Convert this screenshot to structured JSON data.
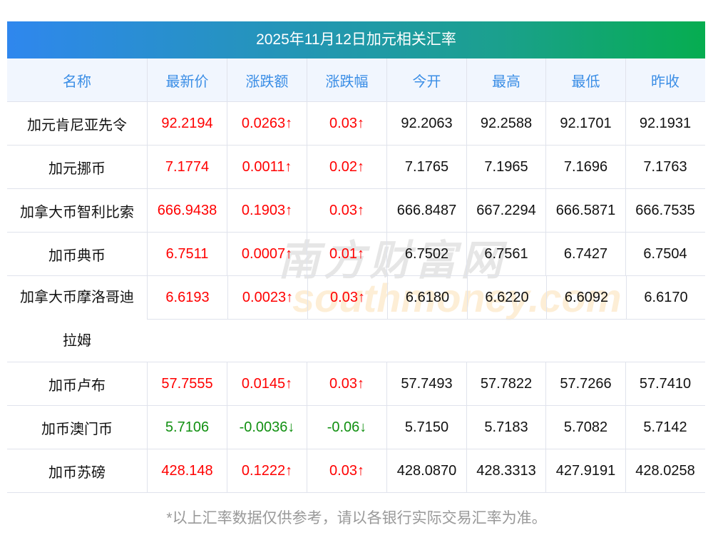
{
  "title": "2025年11月12日加元相关汇率",
  "headers": [
    "名称",
    "最新价",
    "涨跌额",
    "涨跌幅",
    "今开",
    "最高",
    "最低",
    "昨收"
  ],
  "rows": [
    {
      "name": "加元肯尼亚先令",
      "price": "92.2194",
      "chg": "0.0263↑",
      "pct": "0.03↑",
      "open": "92.2063",
      "high": "92.2588",
      "low": "92.1701",
      "prev": "92.1931",
      "dir": "up"
    },
    {
      "name": "加元挪币",
      "price": "7.1774",
      "chg": "0.0011↑",
      "pct": "0.02↑",
      "open": "7.1765",
      "high": "7.1965",
      "low": "7.1696",
      "prev": "7.1763",
      "dir": "up"
    },
    {
      "name": "加拿大币智利比索",
      "price": "666.9438",
      "chg": "0.1903↑",
      "pct": "0.03↑",
      "open": "666.8487",
      "high": "667.2294",
      "low": "666.5871",
      "prev": "666.7535",
      "dir": "up"
    },
    {
      "name": "加币典币",
      "price": "6.7511",
      "chg": "0.0007↑",
      "pct": "0.01↑",
      "open": "6.7502",
      "high": "6.7561",
      "low": "6.7427",
      "prev": "6.7504",
      "dir": "up"
    },
    {
      "name": "加拿大币摩洛哥迪",
      "name2": "拉姆",
      "price": "6.6193",
      "chg": "0.0023↑",
      "pct": "0.03↑",
      "open": "6.6180",
      "high": "6.6220",
      "low": "6.6092",
      "prev": "6.6170",
      "dir": "up"
    },
    {
      "name": "加币卢布",
      "price": "57.7555",
      "chg": "0.0145↑",
      "pct": "0.03↑",
      "open": "57.7493",
      "high": "57.7822",
      "low": "57.7266",
      "prev": "57.7410",
      "dir": "up"
    },
    {
      "name": "加币澳门币",
      "price": "5.7106",
      "chg": "-0.0036↓",
      "pct": "-0.06↓",
      "open": "5.7150",
      "high": "5.7183",
      "low": "5.7082",
      "prev": "5.7142",
      "dir": "down"
    },
    {
      "name": "加币苏磅",
      "price": "428.148",
      "chg": "0.1222↑",
      "pct": "0.03↑",
      "open": "428.0870",
      "high": "428.3313",
      "low": "427.9191",
      "prev": "428.0258",
      "dir": "up"
    }
  ],
  "watermark": {
    "cn": "南方财富网",
    "en": "southmoney.com"
  },
  "footer": "*以上汇率数据仅供参考，请以各银行实际交易汇率为准。"
}
